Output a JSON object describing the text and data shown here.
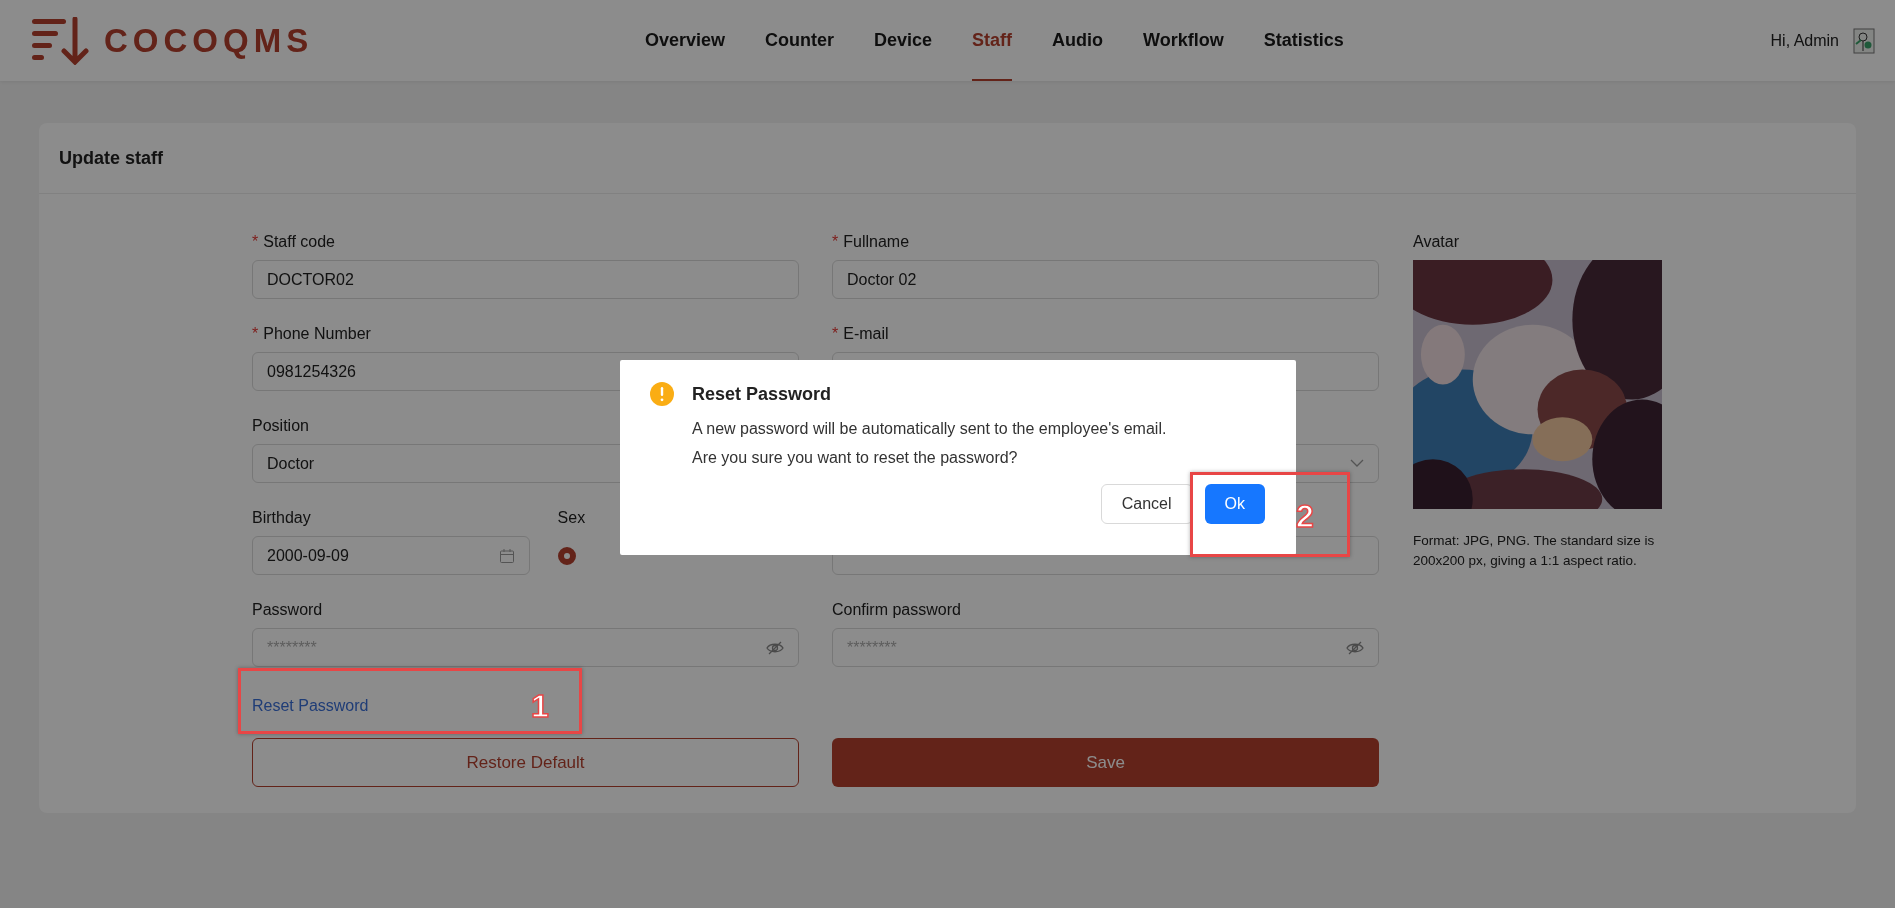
{
  "header": {
    "logo_text": "COCOQMS",
    "nav": [
      {
        "label": "Overview",
        "selected": false
      },
      {
        "label": "Counter",
        "selected": false
      },
      {
        "label": "Device",
        "selected": false
      },
      {
        "label": "Staff",
        "selected": true
      },
      {
        "label": "Audio",
        "selected": false
      },
      {
        "label": "Workflow",
        "selected": false
      },
      {
        "label": "Statistics",
        "selected": false
      }
    ],
    "greeting": "Hi, Admin"
  },
  "card": {
    "title": "Update staff"
  },
  "form": {
    "rows": [
      {
        "left": [
          {
            "kind": "text",
            "required_mark": "*",
            "label": "Staff code",
            "value": "DOCTOR02"
          }
        ],
        "right": [
          {
            "kind": "text",
            "required_mark": "*",
            "label": "Fullname",
            "value": "Doctor 02"
          }
        ]
      },
      {
        "left": [
          {
            "kind": "text",
            "required_mark": "*",
            "label": "Phone Number",
            "value": "0981254326"
          }
        ],
        "right": [
          {
            "kind": "text",
            "required_mark": "*",
            "label": "E-mail"
          }
        ]
      },
      {
        "left": [
          {
            "kind": "text",
            "label": "Position",
            "value": "Doctor"
          }
        ],
        "right": [
          {
            "kind": "select"
          }
        ]
      },
      {
        "left": [
          {
            "kind": "date",
            "label": "Birthday",
            "value": "2000-09-09"
          },
          {
            "kind": "radio",
            "label": "Sex",
            "options": [
              {
                "selected": true
              }
            ]
          }
        ],
        "right": [
          {
            "kind": "text"
          }
        ]
      },
      {
        "left": [
          {
            "kind": "password",
            "label": "Password",
            "placeholder": "********"
          }
        ],
        "right": [
          {
            "kind": "password",
            "label": "Confirm password",
            "placeholder": "********"
          }
        ]
      }
    ],
    "reset_link": "Reset Password",
    "buttons": [
      {
        "label": "Restore Default",
        "kind": "outline"
      },
      {
        "label": "Save",
        "kind": "primary"
      }
    ],
    "avatar": {
      "label": "Avatar",
      "hint": "Format: JPG, PNG. The standard size is 200x200 px, giving a 1:1 aspect ratio."
    }
  },
  "dialog": {
    "title": "Reset Password",
    "message": [
      "A new password will be automatically sent to the employee's email.",
      "Are you sure you want to reset the password?"
    ],
    "buttons": [
      {
        "label": "Cancel",
        "kind": "default"
      },
      {
        "label": "Ok",
        "kind": "primary"
      }
    ]
  },
  "annotations": [
    {
      "number": "1"
    },
    {
      "number": "2"
    }
  ]
}
